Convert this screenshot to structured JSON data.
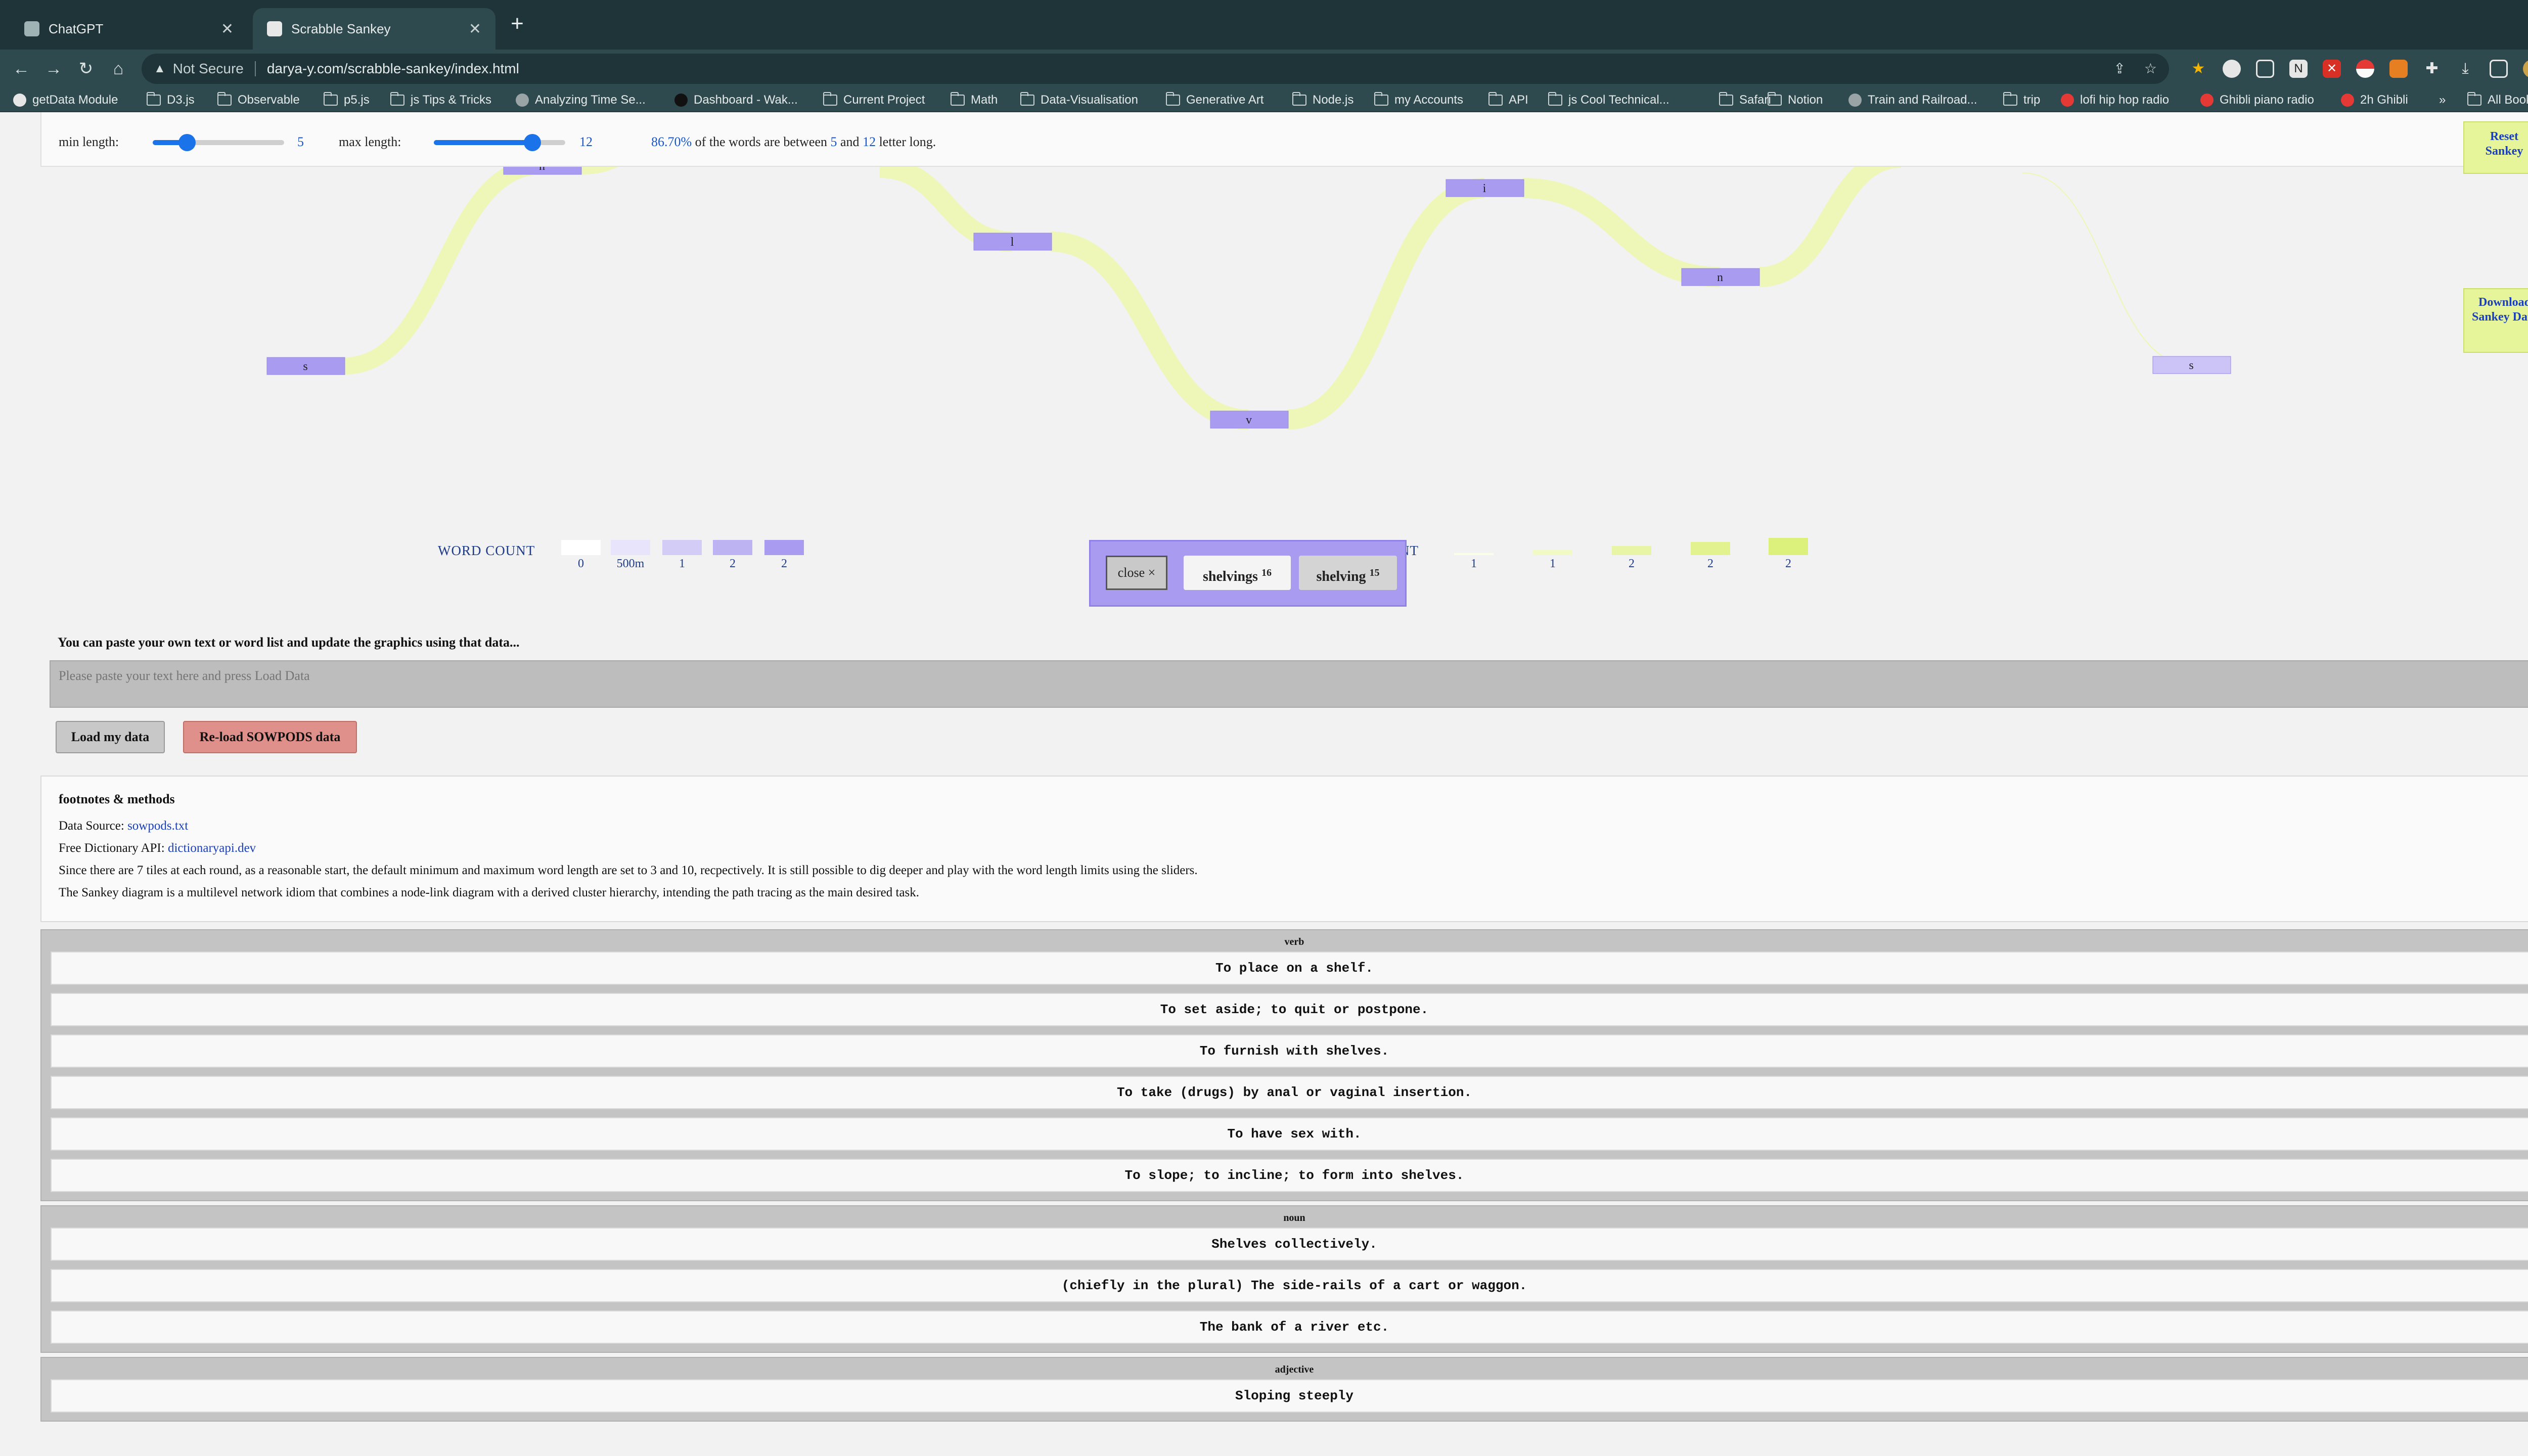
{
  "browser": {
    "tabs": [
      {
        "title": "ChatGPT",
        "active": false
      },
      {
        "title": "Scrabble Sankey",
        "active": true
      }
    ],
    "url": "darya-y.com/scrabble-sankey/index.html",
    "security_label": "Not Secure",
    "bookmarks": [
      "getData Module",
      "D3.js",
      "Observable",
      "p5.js",
      "js Tips & Tricks",
      "Analyzing Time Se...",
      "Dashboard - Wak...",
      "Current Project",
      "Math",
      "Data-Visualisation",
      "Generative Art",
      "Node.js",
      "my Accounts",
      "API",
      "js Cool Technical...",
      "Safari",
      "Notion",
      "Train and Railroad...",
      "trip",
      "lofi hip hop radio",
      "Ghibli piano radio",
      "2h Ghibli"
    ],
    "overflow_label": "»",
    "all_bookmarks": "All Bookmarks"
  },
  "controls": {
    "min_label": "min length:",
    "min_value": "5",
    "min_fraction": 0.26,
    "max_label": "max length:",
    "max_value": "12",
    "max_fraction": 0.75,
    "stat_percent": "86.70%",
    "stat_mid": " of the words are between ",
    "stat_min": "5",
    "stat_and": " and ",
    "stat_max": "12",
    "stat_tail": " letter long.",
    "reset_label": "Reset Sankey",
    "download_label": "Download Sankey Data"
  },
  "sankey": {
    "nodes": [
      "h",
      "s",
      "l",
      "v",
      "i",
      "n",
      "s"
    ],
    "node_color": "#a99cf0",
    "link_color": "#eef7b8"
  },
  "legend": {
    "word_count_title": "WORD COUNT",
    "word_count_labels": [
      "0",
      "500m",
      "1",
      "2",
      "2"
    ],
    "word_count_colors": [
      "#ffffff",
      "#e8e4fb",
      "#d3ccf7",
      "#bdb3f3",
      "#a99cf0"
    ],
    "link_title_fragment": "NT",
    "link_count_labels": [
      "1",
      "1",
      "2",
      "2",
      "2"
    ],
    "link_count_colors": [
      "#fbfde8",
      "#f1f9c4",
      "#e9f5a6",
      "#e2f28e",
      "#dcf07c"
    ]
  },
  "popup": {
    "close_label": "close ×",
    "words": [
      {
        "word": "shelvings",
        "score": "16"
      },
      {
        "word": "shelving",
        "score": "15"
      }
    ]
  },
  "input": {
    "prompt": "You can paste your own text or word list and update the graphics using that data...",
    "placeholder": "Please paste your text here and press Load Data",
    "load_label": "Load my data",
    "reload_label": "Re-load SOWPODS data"
  },
  "footnotes": {
    "title": "footnotes & methods",
    "source_label": "Data Source: ",
    "source_link": "sowpods.txt",
    "api_label": "Free Dictionary API: ",
    "api_link": "dictionaryapi.dev",
    "note1": "Since there are 7 tiles at each round, as a reasonable start, the default minimum and maximum word length are set to 3 and 10, recpectively. It is still possible to dig deeper and play with the word length limits using the sliders.",
    "note2": "The Sankey diagram is a multilevel network idiom that combines a node-link diagram with a derived cluster hierarchy, intending the path tracing as the main desired task."
  },
  "definitions": [
    {
      "pos": "verb",
      "items": [
        "To place on a shelf.",
        "To set aside; to quit or postpone.",
        "To furnish with shelves.",
        "To take (drugs) by anal or vaginal insertion.",
        "To have sex with.",
        "To slope; to incline; to form into shelves."
      ]
    },
    {
      "pos": "noun",
      "items": [
        "Shelves collectively.",
        "(chiefly in the plural) The side-rails of a cart or waggon.",
        "The bank of a river etc."
      ]
    },
    {
      "pos": "adjective",
      "items": [
        "Sloping steeply"
      ]
    }
  ]
}
